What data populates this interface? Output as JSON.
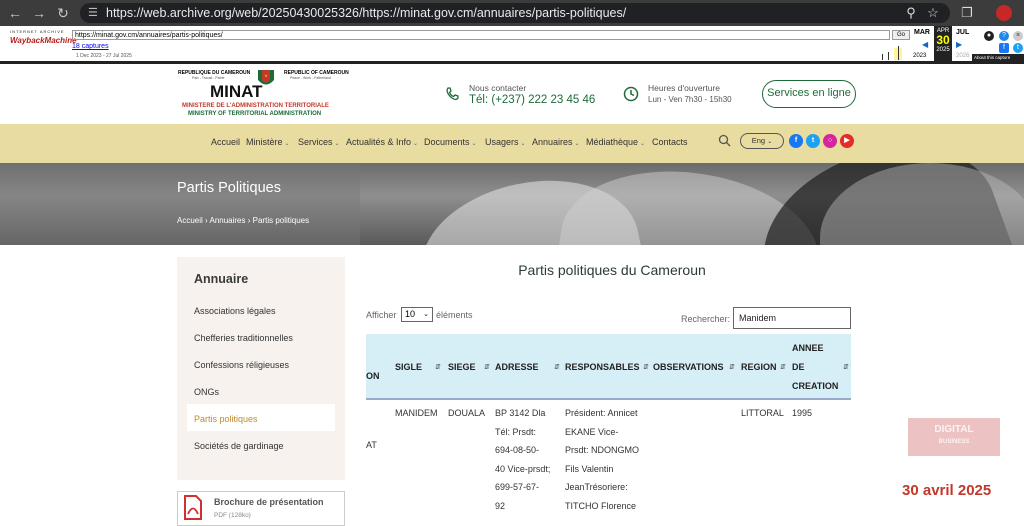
{
  "browser": {
    "url": "https://web.archive.org/web/20250430025326/https://minat.gov.cm/annuaires/partis-politiques/"
  },
  "wayback": {
    "logo_top": "INTERNET ARCHIVE",
    "logo_main": "WaybackMachine",
    "url": "https://minat.gov.cm/annuaires/partis-politiques/",
    "go": "Go",
    "captures": "18 captures",
    "range": "1 Dec 2023 - 27 Jul 2025",
    "prev_month": "MAR",
    "cur_month": "APR",
    "next_month": "JUL",
    "prev_year": "2023",
    "cur_day": "30",
    "cur_year": "2025",
    "next_year": "2026",
    "about": "About this capture"
  },
  "site": {
    "logo_left": "REPUBLIQUE DU CAMEROUN",
    "logo_left_motto": "Paix - Travail - Patrie",
    "logo_right": "REPUBLIC OF CAMEROUN",
    "logo_right_motto": "Peace - Work - Fatherland",
    "logo_name": "MINAT",
    "logo_fr": "MINISTERE DE L'ADMINISTRATION TERRITORIALE",
    "logo_en": "MINISTRY OF TERRITORIAL ADMINISTRATION",
    "contact_label": "Nous contacter",
    "contact_value": "Tél: (+237) 222 23 45 46",
    "hours_label": "Heures d'ouverture",
    "hours_value": "Lun - Ven 7h30 - 15h30",
    "cta": "Services en ligne"
  },
  "nav": {
    "items": [
      "Accueil",
      "Ministère",
      "Services",
      "Actualités & Info",
      "Documents",
      "Usagers",
      "Annuaires",
      "Médiathèque",
      "Contacts"
    ],
    "lang": "Eng"
  },
  "banner": {
    "title": "Partis Politiques",
    "crumbs": [
      "Accueil",
      "Annuaires",
      "Partis politiques"
    ]
  },
  "sidebar": {
    "title": "Annuaire",
    "items": [
      "Associations légales",
      "Chefferies traditionnelles",
      "Confessions réligieuses",
      "ONGs",
      "Partis politiques",
      "Sociétés de gardinage"
    ],
    "brochure_title": "Brochure de présentation",
    "brochure_meta": "PDF (128ko)"
  },
  "main": {
    "title": "Partis politiques du Cameroun",
    "show_label": "Afficher",
    "show_value": "10",
    "show_suffix": "éléments",
    "search_label": "Rechercher:",
    "search_value": "Manidem",
    "headers": [
      "ON",
      "SIGLE",
      "SIEGE",
      "ADRESSE",
      "RESPONSABLES",
      "OBSERVATIONS",
      "REGION",
      "ANNEE",
      "DE",
      "CREATION"
    ],
    "row": {
      "name_frag": "AT",
      "sigle": "MANIDEM",
      "siege": "DOUALA",
      "adresse": [
        "BP 3142 Dla",
        "Tél: Prsdt:",
        "694-08-50-",
        "40 Vice-prsdt;",
        "699-57-67-",
        "92"
      ],
      "responsables": [
        "Président: Annicet",
        "EKANE Vice-",
        "Prsdt: NDONGMO",
        "Fils Valentin",
        "JeanTrésoriere:",
        "TITCHO Florence"
      ],
      "observations": "",
      "region": "LITTORAL",
      "annee": "1995"
    }
  },
  "overlay": {
    "watermark_1": "DIGITAL",
    "watermark_2": "BUSINESS",
    "date": "30 avril 2025"
  },
  "colors": {
    "brand_green": "#1e6b3a",
    "nav_bg": "#e8dca0",
    "table_head": "#d6eef6",
    "accent_red": "#c0392b"
  }
}
